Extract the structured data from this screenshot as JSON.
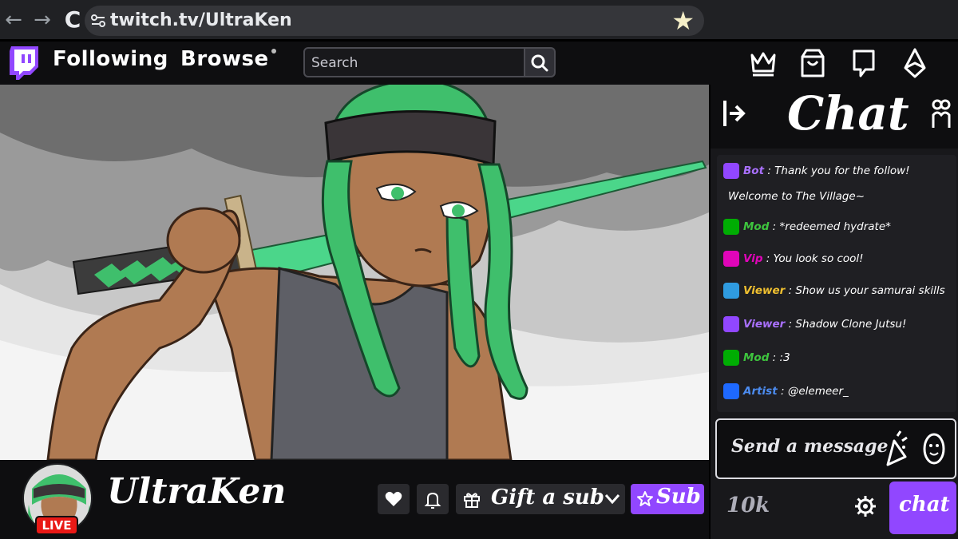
{
  "browser": {
    "url": "twitch.tv/UltraKen"
  },
  "topnav": {
    "following": "Following",
    "browse": "Browse",
    "search_placeholder": "Search"
  },
  "channel": {
    "name": "UltraKen",
    "live_label": "LIVE",
    "gift_label": "Gift a sub",
    "sub_label": "Sub"
  },
  "chat": {
    "title": "Chat",
    "messages": [
      {
        "user": "Bot",
        "sep": " : ",
        "text": "Thank you for the follow!",
        "badge": "bot",
        "user_color": "#a970ff"
      },
      {
        "user": "",
        "sep": "",
        "text": "Welcome to The Village~",
        "badge": "",
        "user_color": "#ffffff"
      },
      {
        "user": "Mod",
        "sep": " : ",
        "text": "*redeemed hydrate*",
        "badge": "mod",
        "user_color": "#3ec43e"
      },
      {
        "user": "Vip",
        "sep": " : ",
        "text": "You look so cool!",
        "badge": "vip",
        "user_color": "#e005b9"
      },
      {
        "user": "Viewer",
        "sep": " : ",
        "text": "Show us your samurai skills",
        "badge": "crown",
        "user_color": "#f0c030"
      },
      {
        "user": "Viewer",
        "sep": " : ",
        "text": "Shadow Clone Jutsu!",
        "badge": "gift",
        "user_color": "#a970ff"
      },
      {
        "user": "Mod",
        "sep": " : ",
        "text": ":3",
        "badge": "mod",
        "user_color": "#3ec43e"
      },
      {
        "user": "Artist",
        "sep": " : ",
        "text": "@elemeer_",
        "badge": "artist",
        "user_color": "#4c8cf0"
      }
    ],
    "input_placeholder": "Send a message",
    "points": "10k",
    "send_label": "chat"
  },
  "colors": {
    "accent": "#9147ff",
    "live": "#e91916",
    "bot_badge": "#9147ff",
    "mod_badge": "#00ad03",
    "vip_badge": "#e005b9",
    "crown_badge": "#2f9be0",
    "gift_badge": "#9147ff",
    "artist_badge": "#1e69ff"
  },
  "icons": {
    "back": "arrow-left-icon",
    "forward": "arrow-right-icon",
    "reload": "reload-icon",
    "site_settings": "tune-icon",
    "bookmark": "star-icon",
    "logo": "twitch-logo-icon",
    "search": "search-icon",
    "prime": "crown-icon",
    "store": "bag-icon",
    "whispers": "speech-bubble-icon",
    "bits": "bits-icon",
    "follow": "heart-icon",
    "notifications": "bell-icon",
    "gift": "gift-icon",
    "subscribe": "star-outline-icon",
    "collapse": "collapse-arrow-icon",
    "community": "users-icon",
    "emote_party": "party-popper-icon",
    "emotes": "smiley-icon",
    "settings": "gear-icon"
  }
}
